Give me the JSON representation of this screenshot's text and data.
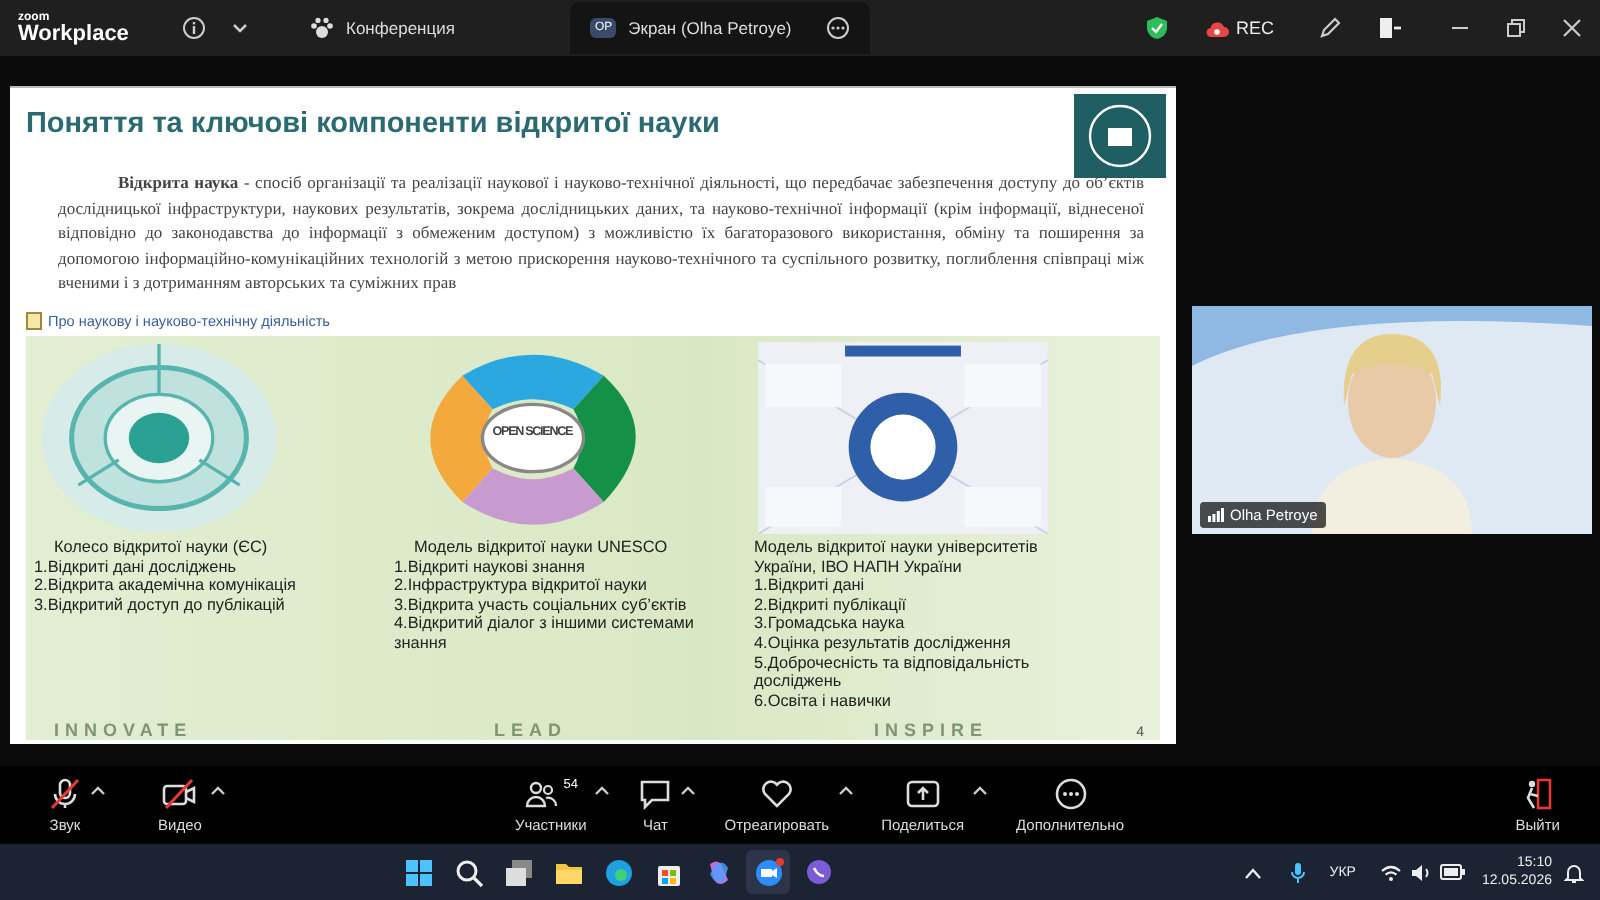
{
  "title_bar": {
    "brand_top": "zoom",
    "brand": "Workplace",
    "tabs": [
      {
        "label": "Конференция",
        "selected": false
      },
      {
        "label": "Экран (Olha Petroye)",
        "initials": "OP",
        "selected": true
      }
    ],
    "rec": "REC"
  },
  "slide": {
    "title": "Поняття та ключові компоненти відкритої науки",
    "definition": "**Відкрита наука** - спосіб організації та реалізації наукової і науково-технічної діяльності, що передбачає забезпечення доступу до об’єктів дослідницької інфраструктури, наукових результатів, зокрема дослідницьких даних, та науково-технічної інформації (крім інформації, віднесеної відповідно до законодавства до інформації з обмеженим доступом) з можливістю їх багаторазового використання, обміну та поширення за допомогою інформаційно-комунікаційних технологій з метою прискорення науково-технічного та суспільного розвитку, поглиблення співпраці між вченими  і з дотриманням авторських та суміжних прав",
    "link": "Про наукову і науково-технічну діяльність",
    "panels": [
      {
        "kind": "wheel",
        "caption": "Колесо відкритої науки (ЄС)",
        "items": [
          "1.Відкриті дані досліджень",
          "2.Відкрита академічна комунікація",
          "3.Відкритий доступ до публікацій"
        ]
      },
      {
        "kind": "puzzle",
        "image_text": "OPEN SCIENCE",
        "caption": "Модель відкритої науки  UNESCO",
        "items": [
          "1.Відкриті  наукові знання",
          "2.Інфраструктура відкритої науки",
          "3.Відкрита участь соціальних суб’єктів",
          "4.Відкритий діалог з іншими системами знання"
        ]
      },
      {
        "kind": "scheme",
        "caption": "Модель відкритої науки університетів України, ІВО НАПН України",
        "items": [
          "1.Відкриті дані",
          "2.Відкриті публікації",
          "3.Громадська наука",
          "4.Оцінка результатів дослідження",
          "5.Доброчесність та відповідальність досліджень",
          "6.Освіта і навички"
        ]
      }
    ],
    "footer": [
      "INNOVATE",
      "LEAD",
      "INSPIRE"
    ],
    "page_number": "4"
  },
  "video": {
    "name": "Olha Petroye"
  },
  "toolbar": {
    "buttons": [
      {
        "kind": "mic",
        "label": "Звук",
        "muted": true,
        "caret": true
      },
      {
        "kind": "camera",
        "label": "Видео",
        "muted": true,
        "caret": true
      },
      {
        "kind": "participants",
        "label": "Участники",
        "count": "54",
        "caret": true
      },
      {
        "kind": "chat",
        "label": "Чат",
        "caret": true
      },
      {
        "kind": "react",
        "label": "Отреагировать",
        "caret": true
      },
      {
        "kind": "share",
        "label": "Поделиться",
        "caret": true
      },
      {
        "kind": "more",
        "label": "Дополнительно",
        "caret": false
      }
    ],
    "leave": "Выйти"
  },
  "taskbar": {
    "language": "УКР",
    "time": "15:10",
    "date": "12.05.2026"
  }
}
